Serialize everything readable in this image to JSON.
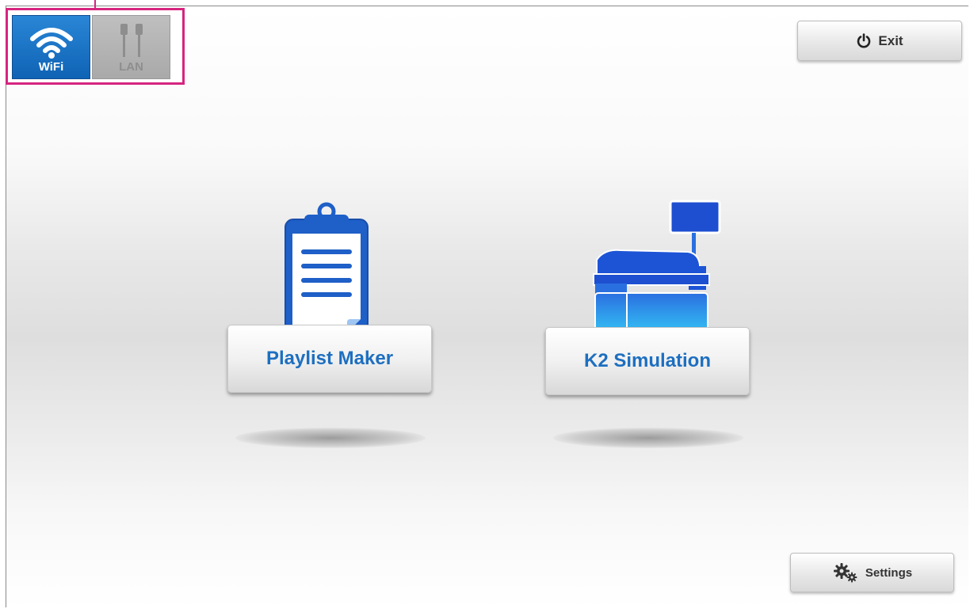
{
  "network": {
    "wifi_label": "WiFi",
    "lan_label": "LAN",
    "selected": "WiFi",
    "highlight_color": "#d6247f"
  },
  "toolbar": {
    "exit_label": "Exit",
    "settings_label": "Settings"
  },
  "apps": [
    {
      "label": "Playlist Maker",
      "icon": "clipboard-icon"
    },
    {
      "label": "K2 Simulation",
      "icon": "hospital-bed-monitor-icon"
    }
  ],
  "colors": {
    "accent": "#1d6fc0",
    "wifi_active": "#1668bf",
    "lan_inactive": "#b3b3b3"
  }
}
